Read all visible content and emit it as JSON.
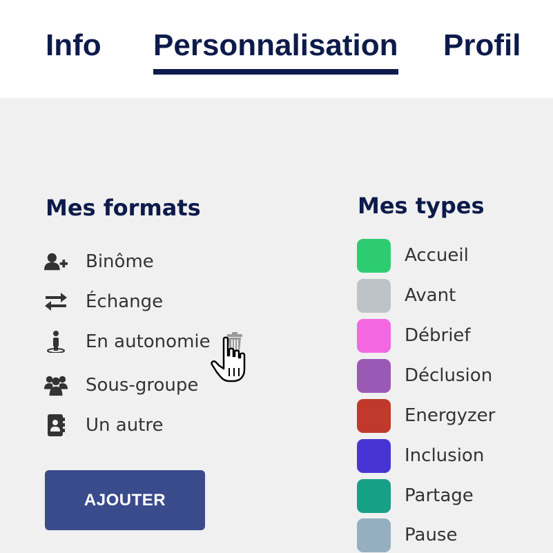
{
  "tabs": [
    {
      "label": "Info",
      "active": false
    },
    {
      "label": "Personnalisation",
      "active": true
    },
    {
      "label": "Profil",
      "active": false
    }
  ],
  "formats": {
    "title": "Mes formats",
    "items": [
      {
        "label": "Binôme",
        "icon": "user-plus-icon"
      },
      {
        "label": "Échange",
        "icon": "exchange-arrows-icon"
      },
      {
        "label": "En autonomie",
        "icon": "standing-person-icon"
      },
      {
        "label": "Sous-groupe",
        "icon": "group-icon"
      },
      {
        "label": "Un autre",
        "icon": "contact-book-icon"
      }
    ],
    "add_button": "AJOUTER"
  },
  "types": {
    "title": "Mes types",
    "items": [
      {
        "label": "Accueil",
        "color": "#2ecc71"
      },
      {
        "label": "Avant",
        "color": "#bdc3c7"
      },
      {
        "label": "Débrief",
        "color": "#f368e0"
      },
      {
        "label": "Déclusion",
        "color": "#9b59b6"
      },
      {
        "label": "Energyzer",
        "color": "#c0392b"
      },
      {
        "label": "Inclusion",
        "color": "#4834d4"
      },
      {
        "label": "Partage",
        "color": "#16a085"
      },
      {
        "label": "Pause",
        "color": "#95afc0"
      }
    ]
  },
  "colors": {
    "primary": "#0d1b4b",
    "button": "#3a4b8c",
    "background": "#f0f0f0"
  }
}
